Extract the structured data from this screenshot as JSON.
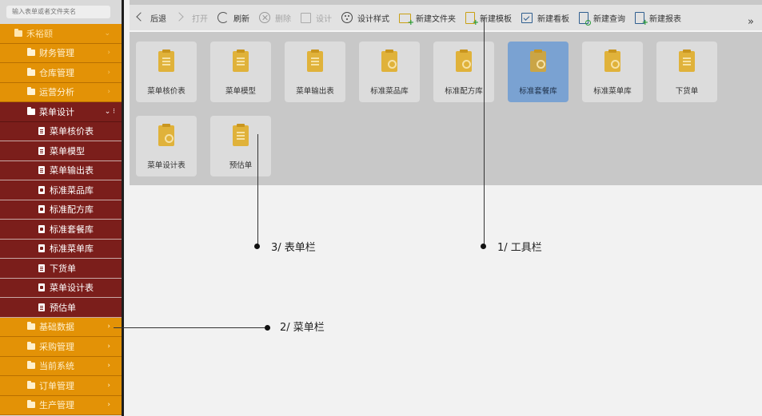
{
  "search": {
    "placeholder": "输入表单或者文件夹名"
  },
  "sidebar": {
    "root": {
      "label": "禾裕颐"
    },
    "groups_before": [
      {
        "label": "财务管理"
      },
      {
        "label": "仓库管理"
      },
      {
        "label": "运营分析"
      }
    ],
    "open_group": {
      "label": "菜单设计"
    },
    "leaves": [
      {
        "label": "菜单核价表",
        "icon": "list-doc-icon"
      },
      {
        "label": "菜单模型",
        "icon": "list-doc-icon"
      },
      {
        "label": "菜单输出表",
        "icon": "list-doc-icon"
      },
      {
        "label": "标准菜品库",
        "icon": "image-doc-icon"
      },
      {
        "label": "标准配方库",
        "icon": "image-doc-icon"
      },
      {
        "label": "标准套餐库",
        "icon": "image-doc-icon"
      },
      {
        "label": "标准菜单库",
        "icon": "image-doc-icon"
      },
      {
        "label": "下货单",
        "icon": "list-doc-icon"
      },
      {
        "label": "菜单设计表",
        "icon": "image-doc-icon"
      },
      {
        "label": "预估单",
        "icon": "list-doc-icon"
      }
    ],
    "groups_after": [
      {
        "label": "基础数据"
      },
      {
        "label": "采购管理"
      },
      {
        "label": "当前系统"
      },
      {
        "label": "订单管理"
      },
      {
        "label": "生产管理"
      }
    ]
  },
  "toolbar": {
    "back": "后退",
    "open": "打开",
    "refresh": "刷新",
    "delete": "删除",
    "design": "设计",
    "design_style": "设计样式",
    "new_folder": "新建文件夹",
    "new_template": "新建模板",
    "new_board": "新建看板",
    "new_query": "新建查询",
    "new_report": "新建报表",
    "more": "»"
  },
  "forms": [
    {
      "label": "菜单核价表",
      "icon": "clipboard-icon"
    },
    {
      "label": "菜单模型",
      "icon": "clipboard-icon"
    },
    {
      "label": "菜单输出表",
      "icon": "clipboard-icon"
    },
    {
      "label": "标准菜品库",
      "icon": "gear-doc-icon"
    },
    {
      "label": "标准配方库",
      "icon": "gear-doc-icon"
    },
    {
      "label": "标准套餐库",
      "icon": "gear-doc-icon",
      "selected": true
    },
    {
      "label": "标准菜单库",
      "icon": "gear-doc-icon"
    },
    {
      "label": "下货单",
      "icon": "clipboard-icon"
    },
    {
      "label": "菜单设计表",
      "icon": "gear-doc-icon"
    },
    {
      "label": "预估单",
      "icon": "clipboard-icon"
    }
  ],
  "annotations": {
    "toolbar": "1/ 工具栏",
    "menubar": "2/ 菜单栏",
    "formbar": "3/ 表单栏"
  },
  "colors": {
    "menu_orange": "#e39206",
    "menu_dark_red": "#7b1e1b",
    "selected_tile": "#7aa2d2",
    "icon_gold": "#e0b23a"
  }
}
